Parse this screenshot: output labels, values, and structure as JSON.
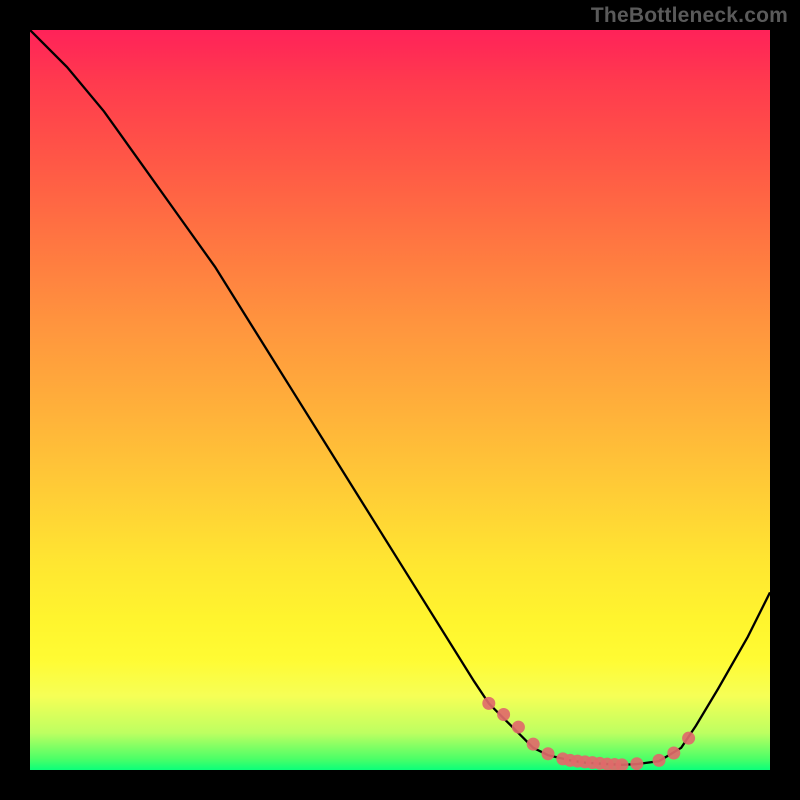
{
  "watermark": "TheBottleneck.com",
  "colors": {
    "curve_stroke": "#000000",
    "marker_fill": "#e06a6a",
    "marker_fill_alt": "#dd7a7a",
    "plot_border": "#000000",
    "watermark_color": "#5a5a5a"
  },
  "chart_data": {
    "type": "line",
    "title": "",
    "xlabel": "",
    "ylabel": "",
    "xlim": [
      0,
      100
    ],
    "ylim": [
      0,
      100
    ],
    "grid": false,
    "legend": false,
    "series": [
      {
        "name": "curve",
        "x": [
          0,
          5,
          10,
          15,
          20,
          25,
          30,
          35,
          40,
          45,
          50,
          55,
          60,
          62,
          65,
          68,
          70,
          73,
          75,
          78,
          80,
          82,
          85,
          88,
          90,
          93,
          97,
          100
        ],
        "y": [
          100,
          95,
          89,
          82,
          75,
          68,
          60,
          52,
          44,
          36,
          28,
          20,
          12,
          9,
          6,
          3,
          2,
          1.3,
          1.0,
          0.8,
          0.7,
          0.8,
          1.2,
          3,
          6,
          11,
          18,
          24
        ]
      }
    ],
    "markers": {
      "name": "valley-highlight",
      "x": [
        62,
        64,
        66,
        68,
        70,
        72,
        73,
        74,
        75,
        76,
        77,
        78,
        79,
        80,
        82,
        85,
        87,
        89
      ],
      "y": [
        9,
        7.5,
        5.8,
        3.5,
        2.2,
        1.5,
        1.3,
        1.2,
        1.1,
        1.0,
        0.9,
        0.8,
        0.75,
        0.7,
        0.85,
        1.3,
        2.3,
        4.3
      ]
    },
    "gradient_bands": [
      {
        "pos": 0.0,
        "color": "#ff2259"
      },
      {
        "pos": 0.18,
        "color": "#ff5846"
      },
      {
        "pos": 0.4,
        "color": "#ff953e"
      },
      {
        "pos": 0.63,
        "color": "#ffce36"
      },
      {
        "pos": 0.8,
        "color": "#fff52e"
      },
      {
        "pos": 0.95,
        "color": "#bdff61"
      },
      {
        "pos": 1.0,
        "color": "#0bff7a"
      }
    ]
  }
}
